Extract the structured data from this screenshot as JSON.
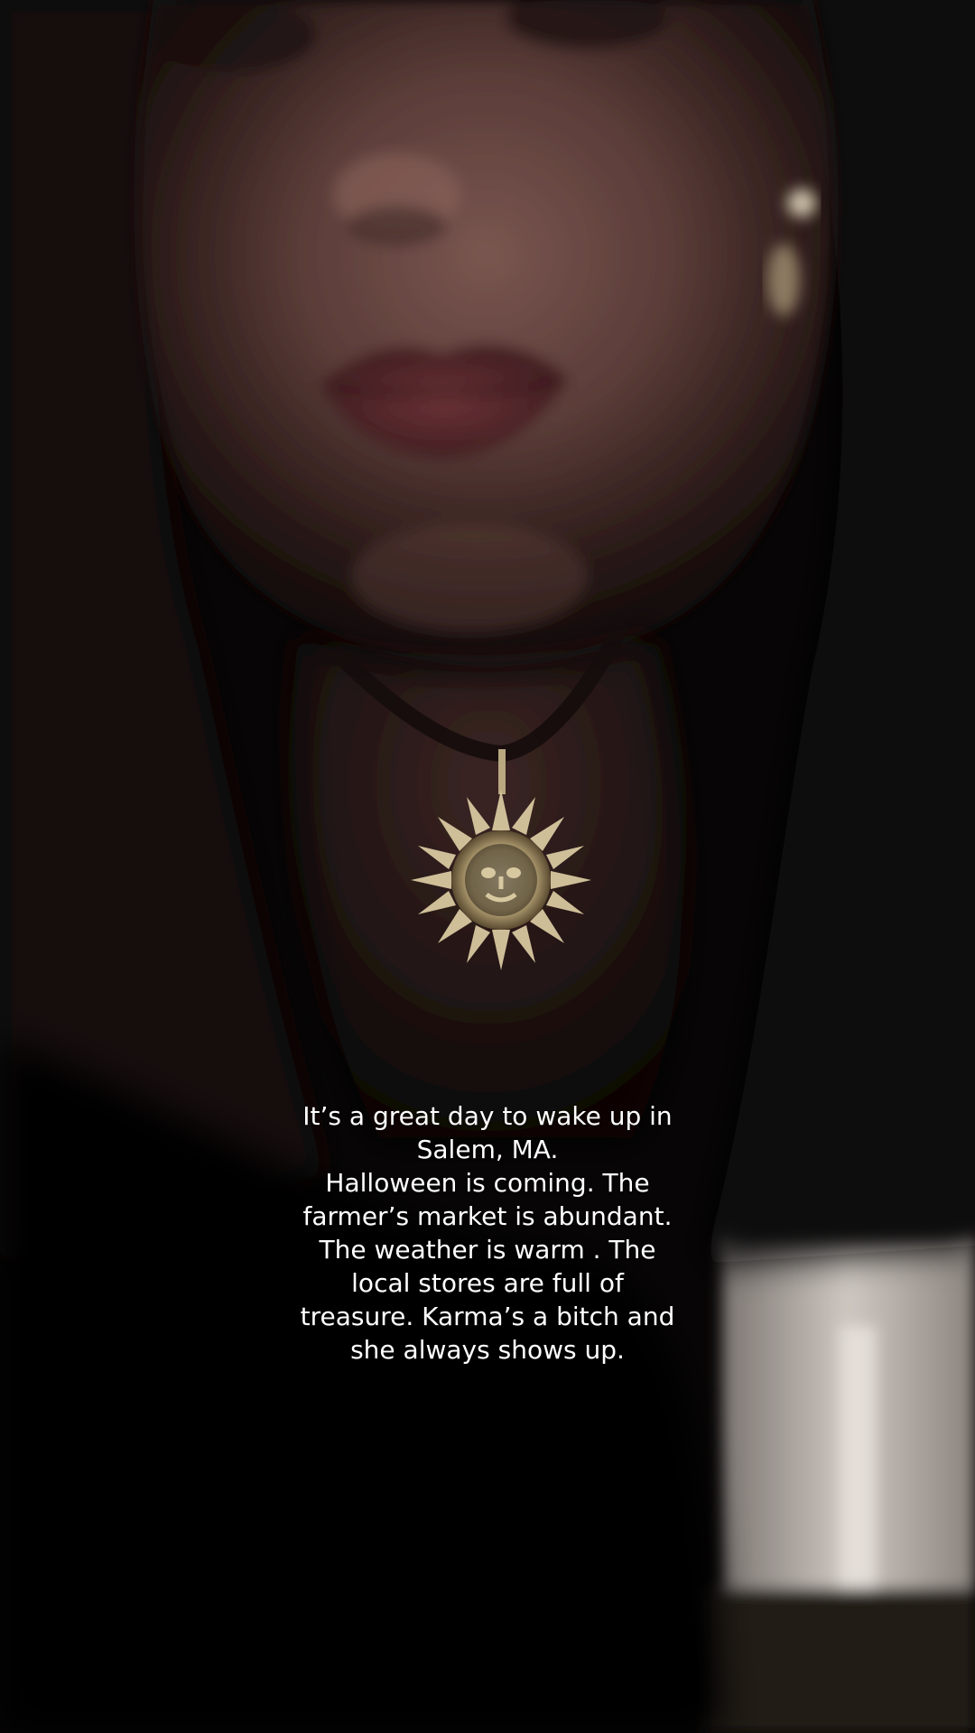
{
  "caption": {
    "text": "It’s a great day to wake up in\nSalem, MA.\nHalloween is coming. The\nfarmer’s market is abundant.\nThe weather is warm . The\nlocal stores are full of\ntreasure. Karma’s a bitch and\nshe always shows up."
  },
  "scene": {
    "description_colors": {
      "background": "#060404",
      "skin": "#6a4a46",
      "lips": "#5a2a2e",
      "hair": "#120c0b",
      "pendant": "#d8c8a0",
      "cord": "#1a1010",
      "wall": "#cfc8c2"
    }
  }
}
